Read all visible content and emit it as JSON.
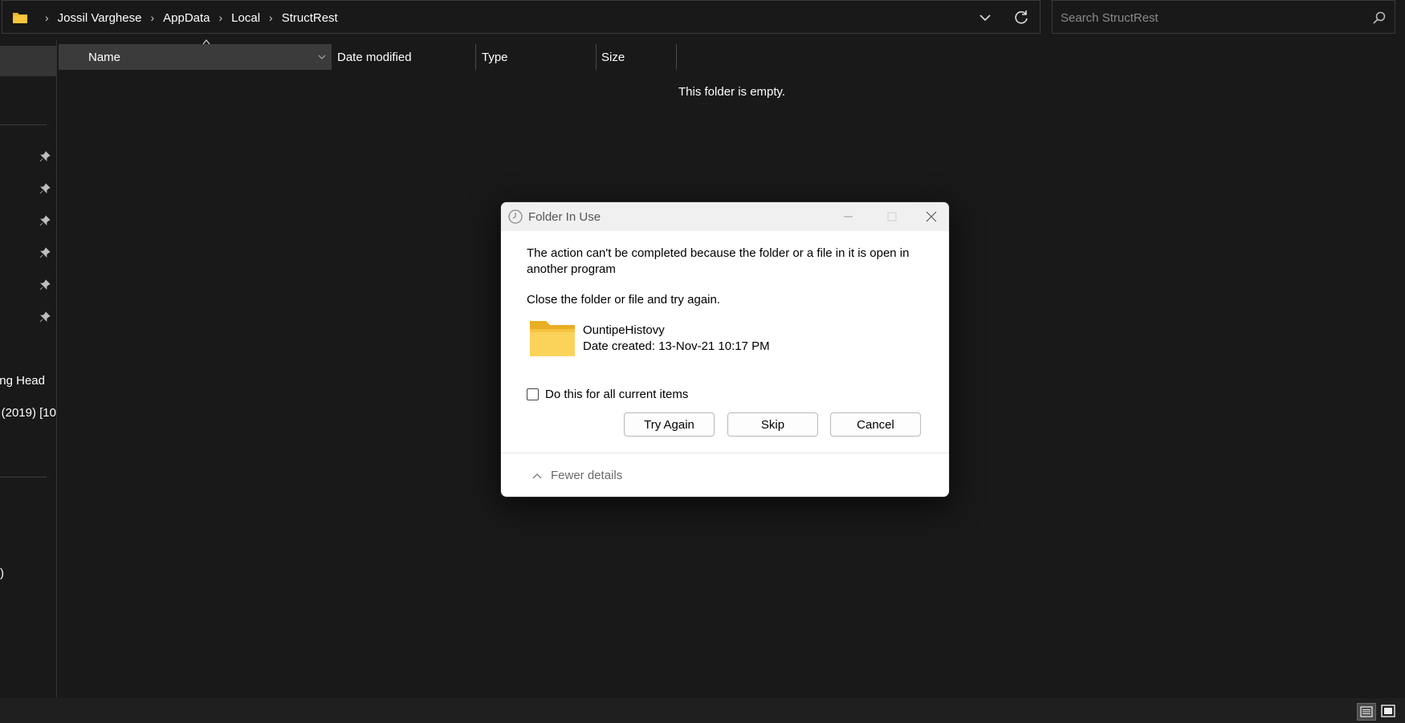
{
  "address_bar": {
    "breadcrumbs": [
      "Jossil Varghese",
      "AppData",
      "Local",
      "StructRest"
    ],
    "folder_icon": "folder-icon",
    "expand_icon": "chevron-down-icon",
    "refresh_icon": "refresh-icon"
  },
  "search": {
    "placeholder": "Search StructRest",
    "icon": "search-icon"
  },
  "nav_pane": {
    "items": [
      "ng Head",
      "(2019) [10",
      ")"
    ],
    "pin_icon": "pin-icon"
  },
  "columns": {
    "name": "Name",
    "date_modified": "Date modified",
    "type": "Type",
    "size": "Size"
  },
  "main": {
    "empty_message": "This folder is empty."
  },
  "dialog": {
    "title": "Folder In Use",
    "message": "The action can't be completed because the folder or a file in it is open in another program",
    "sub_message": "Close the folder or file and try again.",
    "file_name": "OuntipeHistovy",
    "file_date": "Date created: 13-Nov-21 10:17 PM",
    "checkbox_label": "Do this for all current items",
    "checkbox_checked": false,
    "buttons": {
      "try_again": "Try Again",
      "skip": "Skip",
      "cancel": "Cancel"
    },
    "details_toggle": "Fewer details"
  },
  "colors": {
    "background": "#191919",
    "folder_yellow": "#f8c63a",
    "dialog_bg": "#ffffff"
  }
}
